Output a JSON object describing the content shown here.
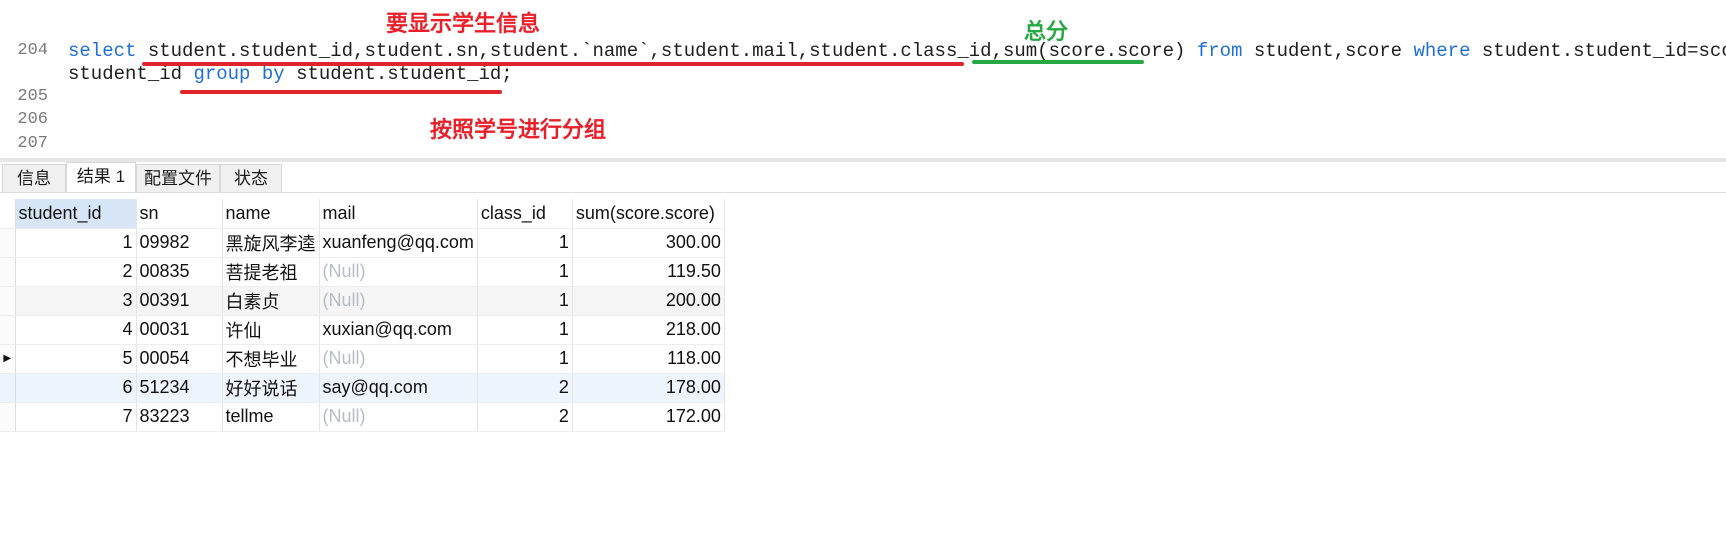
{
  "editor": {
    "line_numbers": [
      "204",
      "205",
      "206",
      "207"
    ],
    "sql": {
      "kw_select": "select",
      "select_cols": "student.student_id,student.sn,student.`name`,student.mail,student.class_id,",
      "agg": "sum(score.score)",
      "kw_from": "from",
      "tables": "student,score",
      "kw_where": "where",
      "cond": "student.student_id=score.",
      "cond_cont": "student_id",
      "kw_group_by": "group by",
      "group_col": "student.student_id;"
    },
    "annotations": {
      "show_info": "要显示学生信息",
      "total": "总分",
      "group": "按照学号进行分组"
    },
    "colors": {
      "keyword": "#1f6fd6",
      "annot_red": "#e8202a",
      "annot_green": "#27a844"
    }
  },
  "tabs": [
    {
      "label": "信息",
      "active": false
    },
    {
      "label": "结果 1",
      "active": true
    },
    {
      "label": "配置文件",
      "active": false
    },
    {
      "label": "状态",
      "active": false
    }
  ],
  "grid": {
    "columns": [
      "student_id",
      "sn",
      "name",
      "mail",
      "class_id",
      "sum(score.score)"
    ],
    "rows": [
      {
        "student_id": "1",
        "sn": "09982",
        "name": "黑旋风李逵",
        "mail": "xuanfeng@qq.com",
        "class_id": "1",
        "sum": "300.00"
      },
      {
        "student_id": "2",
        "sn": "00835",
        "name": "菩提老祖",
        "mail": "(Null)",
        "class_id": "1",
        "sum": "119.50"
      },
      {
        "student_id": "3",
        "sn": "00391",
        "name": "白素贞",
        "mail": "(Null)",
        "class_id": "1",
        "sum": "200.00"
      },
      {
        "student_id": "4",
        "sn": "00031",
        "name": "许仙",
        "mail": "xuxian@qq.com",
        "class_id": "1",
        "sum": "218.00"
      },
      {
        "student_id": "5",
        "sn": "00054",
        "name": "不想毕业",
        "mail": "(Null)",
        "class_id": "1",
        "sum": "118.00"
      },
      {
        "student_id": "6",
        "sn": "51234",
        "name": "好好说话",
        "mail": "say@qq.com",
        "class_id": "2",
        "sum": "178.00"
      },
      {
        "student_id": "7",
        "sn": "83223",
        "name": "tellme",
        "mail": "(Null)",
        "class_id": "2",
        "sum": "172.00"
      }
    ],
    "current_row_marker": "▶"
  }
}
